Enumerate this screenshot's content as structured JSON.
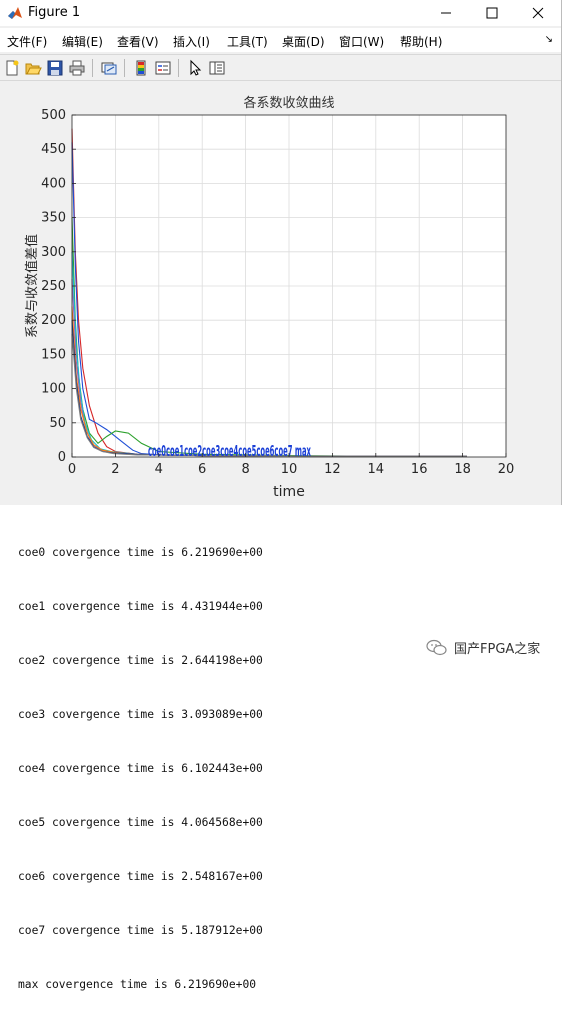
{
  "window": {
    "title": "Figure 1"
  },
  "menu": {
    "items": [
      "文件(F)",
      "编辑(E)",
      "查看(V)",
      "插入(I)",
      "工具(T)",
      "桌面(D)",
      "窗口(W)",
      "帮助(H)"
    ]
  },
  "toolbar": {
    "icons": [
      "new-figure-icon",
      "open-folder-icon",
      "save-icon",
      "print-icon",
      "link-plot-icon",
      "colorbar-icon",
      "legend-icon",
      "pointer-icon",
      "property-editor-icon"
    ]
  },
  "chart_data": {
    "type": "line",
    "title": "各系数收敛曲线",
    "xlabel": "time",
    "ylabel": "系数与收敛值差值",
    "xlim": [
      0,
      20
    ],
    "ylim": [
      0,
      500
    ],
    "xticks": [
      "0",
      "2",
      "4",
      "6",
      "8",
      "10",
      "12",
      "14",
      "16",
      "18",
      "20"
    ],
    "yticks": [
      "0",
      "50",
      "100",
      "150",
      "200",
      "250",
      "300",
      "350",
      "400",
      "450",
      "500"
    ],
    "grid": true,
    "series": [
      {
        "color": "#d62728",
        "x": [
          0,
          0.15,
          0.3,
          0.5,
          0.8,
          1.2,
          1.6,
          2.0,
          2.5,
          3.0,
          4.0,
          6.0,
          10.0,
          14.0,
          18.2
        ],
        "y": [
          480,
          300,
          200,
          130,
          75,
          35,
          15,
          8,
          6,
          4,
          3,
          2,
          1.5,
          1,
          1
        ]
      },
      {
        "color": "#1f4fd6",
        "x": [
          0,
          0.15,
          0.3,
          0.5,
          0.8,
          1.1,
          1.6,
          2.2,
          2.8,
          3.2,
          4.0,
          6.0,
          10.0,
          14.0,
          18.2
        ],
        "y": [
          460,
          280,
          170,
          100,
          55,
          50,
          40,
          25,
          10,
          5,
          3,
          2,
          1.5,
          1,
          1
        ]
      },
      {
        "color": "#2ca02c",
        "x": [
          0,
          0.15,
          0.3,
          0.5,
          0.8,
          1.2,
          1.6,
          2.0,
          2.6,
          3.2,
          4.0,
          6.0,
          10.0,
          14.0,
          18.2
        ],
        "y": [
          350,
          200,
          120,
          70,
          35,
          20,
          30,
          38,
          35,
          20,
          8,
          4,
          2,
          1,
          1
        ]
      },
      {
        "color": "#17becf",
        "x": [
          0,
          0.2,
          0.4,
          0.6,
          0.9,
          1.3,
          1.8,
          2.4,
          3.0,
          4.0,
          6.0,
          10.0,
          14.0,
          18.2
        ],
        "y": [
          300,
          160,
          90,
          50,
          25,
          12,
          8,
          6,
          4,
          3,
          2,
          1.5,
          1,
          1
        ]
      },
      {
        "color": "#9467bd",
        "x": [
          0,
          0.2,
          0.4,
          0.6,
          0.9,
          1.3,
          1.8,
          2.4,
          3.0,
          4.0,
          6.0,
          10.0,
          14.0,
          18.2
        ],
        "y": [
          260,
          140,
          80,
          45,
          20,
          10,
          6,
          5,
          4,
          3,
          2,
          1.5,
          1,
          1
        ]
      },
      {
        "color": "#ff7f0e",
        "x": [
          0,
          0.2,
          0.4,
          0.7,
          1.0,
          1.4,
          1.9,
          2.5,
          3.0,
          4.0,
          6.0,
          10.0,
          14.0,
          18.2
        ],
        "y": [
          220,
          120,
          70,
          35,
          18,
          10,
          7,
          5,
          4,
          3,
          2,
          1.5,
          1,
          1
        ]
      },
      {
        "color": "#1a3a8a",
        "x": [
          0,
          0.2,
          0.4,
          0.7,
          1.0,
          1.4,
          1.9,
          2.5,
          3.0,
          4.0,
          6.0,
          10.0,
          14.0,
          18.2
        ],
        "y": [
          200,
          110,
          60,
          30,
          15,
          8,
          6,
          5,
          4,
          3,
          2,
          1.5,
          1,
          1
        ]
      },
      {
        "color": "#7f7f7f",
        "x": [
          0,
          0.2,
          0.4,
          0.7,
          1.0,
          1.4,
          1.9,
          2.5,
          3.0,
          4.0,
          6.0,
          10.0,
          14.0,
          18.2
        ],
        "y": [
          180,
          100,
          55,
          28,
          14,
          8,
          5,
          4,
          3,
          3,
          2,
          1.5,
          1,
          1
        ]
      }
    ],
    "overlap_label": {
      "text": "coe0coe1coe2coe3coe4coe5coe6coe7 max",
      "x_range": [
        3.5,
        11
      ],
      "y": 0,
      "color": "#1a3fd6"
    }
  },
  "console": {
    "lines": [
      "coe0 covergence time is 6.219690e+00",
      "coe1 covergence time is 4.431944e+00",
      "coe2 covergence time is 2.644198e+00",
      "coe3 covergence time is 3.093089e+00",
      "coe4 covergence time is 6.102443e+00",
      "coe5 covergence time is 4.064568e+00",
      "coe6 covergence time is 2.548167e+00",
      "coe7 covergence time is 5.187912e+00",
      "max covergence time is 6.219690e+00"
    ]
  },
  "watermark": {
    "text": "国产FPGA之家"
  }
}
